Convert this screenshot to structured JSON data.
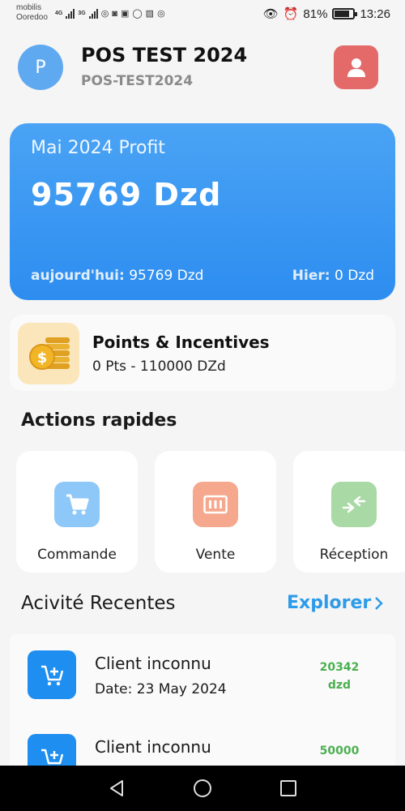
{
  "status_bar": {
    "carrier_line1": "mobilis",
    "carrier_line2": "Ooredoo",
    "net1": "4G",
    "net2": "3G",
    "battery_percent": "81%",
    "battery_level": 0.81,
    "time": "13:26"
  },
  "header": {
    "avatar_letter": "P",
    "store_name": "POS TEST 2024",
    "store_code": "POS-TEST2024",
    "profile_icon": "user-icon"
  },
  "profit": {
    "title": "Mai 2024 Profit",
    "amount": "95769 Dzd",
    "today_label": "aujourd'hui:",
    "today_value": "95769 Dzd",
    "yesterday_label": "Hier:",
    "yesterday_value": "0 Dzd"
  },
  "points": {
    "icon": "coins-icon",
    "title": "Points & Incentives",
    "subtitle": "0 Pts - 110000 DZd"
  },
  "quick_actions": {
    "title": "Actions rapides",
    "items": [
      {
        "label": "Commande",
        "icon": "cart-icon",
        "color": "#8ec8f8"
      },
      {
        "label": "Vente",
        "icon": "register-icon",
        "color": "#f5a88e"
      },
      {
        "label": "Réception",
        "icon": "transfer-icon",
        "color": "#a9d9a5"
      }
    ]
  },
  "recent": {
    "title": "Acivité Recentes",
    "explore_label": "Explorer",
    "items": [
      {
        "name": "Client inconnu",
        "date": "Date:  23 May 2024",
        "amount": "20342",
        "unit": "dzd"
      },
      {
        "name": "Client inconnu",
        "amount": "50000"
      }
    ]
  },
  "colors": {
    "primary": "#2d8df0",
    "accent_green": "#4caf50",
    "profile_red": "#e46a6a"
  }
}
